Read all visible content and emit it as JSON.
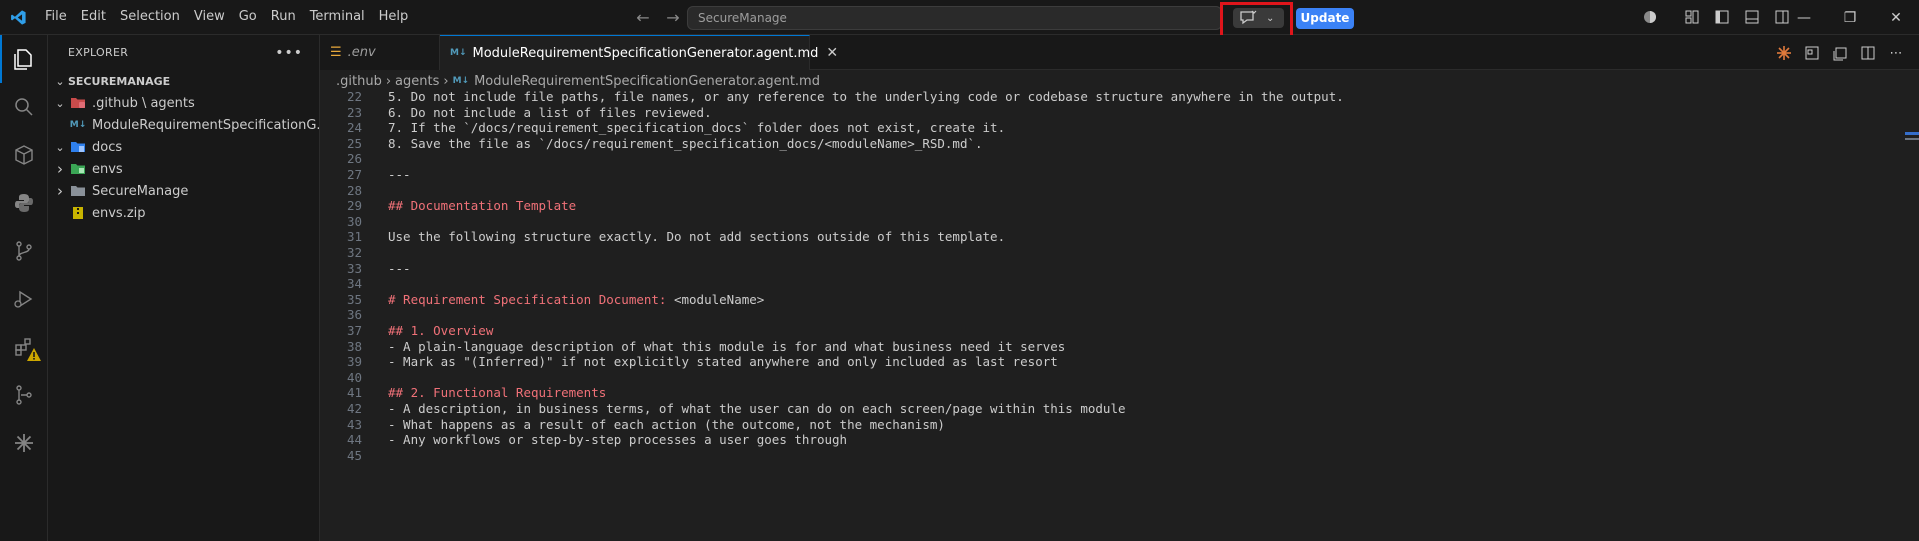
{
  "menu": [
    "File",
    "Edit",
    "Selection",
    "View",
    "Go",
    "Run",
    "Terminal",
    "Help"
  ],
  "command_center": {
    "placeholder": "SecureManage"
  },
  "update_button": "Update",
  "explorer": {
    "title": "EXPLORER",
    "more": "•••",
    "section": "SECUREMANAGE",
    "tree": [
      {
        "label": ".github \\ agents",
        "indent": 1,
        "kind": "folder-open",
        "chevron": "open"
      },
      {
        "label": "ModuleRequirementSpecificationG...",
        "indent": 2,
        "kind": "md",
        "chevron": "none"
      },
      {
        "label": "docs",
        "indent": 1,
        "kind": "folder-docs",
        "chevron": "open"
      },
      {
        "label": "envs",
        "indent": 1,
        "kind": "folder-envs",
        "chevron": "closed"
      },
      {
        "label": "SecureManage",
        "indent": 1,
        "kind": "folder",
        "chevron": "closed"
      },
      {
        "label": "envs.zip",
        "indent": 1,
        "kind": "zip",
        "chevron": "none"
      }
    ]
  },
  "tabs": [
    {
      "label": ".env",
      "active": false
    },
    {
      "label": "ModuleRequirementSpecificationGenerator.agent.md",
      "active": true
    }
  ],
  "breadcrumb": [
    ".github",
    "agents",
    "ModuleRequirementSpecificationGenerator.agent.md"
  ],
  "editor_lines": [
    {
      "n": "22",
      "text": "5. Do not include file paths, file names, or any reference to the underlying code or codebase structure anywhere in the output.",
      "style": "normal"
    },
    {
      "n": "23",
      "text": "6. Do not include a list of files reviewed.",
      "style": "normal"
    },
    {
      "n": "24",
      "text": "7. If the `/docs/requirement_specification_docs` folder does not exist, create it.",
      "style": "normal"
    },
    {
      "n": "25",
      "text": "8. Save the file as `/docs/requirement_specification_docs/<moduleName>_RSD.md`.",
      "style": "normal"
    },
    {
      "n": "26",
      "text": "",
      "style": "normal"
    },
    {
      "n": "27",
      "text": "---",
      "style": "normal"
    },
    {
      "n": "28",
      "text": "",
      "style": "normal"
    },
    {
      "n": "29",
      "text": "## Documentation Template",
      "style": "heading"
    },
    {
      "n": "30",
      "text": "",
      "style": "normal"
    },
    {
      "n": "31",
      "text": "Use the following structure exactly. Do not add sections outside of this template.",
      "style": "normal"
    },
    {
      "n": "32",
      "text": "",
      "style": "normal"
    },
    {
      "n": "33",
      "text": "---",
      "style": "normal"
    },
    {
      "n": "34",
      "text": "",
      "style": "normal"
    },
    {
      "n": "35",
      "text": "# Requirement Specification Document: ",
      "style": "heading",
      "tail": "<moduleName>"
    },
    {
      "n": "36",
      "text": "",
      "style": "normal"
    },
    {
      "n": "37",
      "text": "## 1. Overview",
      "style": "heading"
    },
    {
      "n": "38",
      "text": "- A plain-language description of what this module is for and what business need it serves",
      "style": "normal"
    },
    {
      "n": "39",
      "text": "- Mark as \"(Inferred)\" if not explicitly stated anywhere and only included as last resort",
      "style": "normal"
    },
    {
      "n": "40",
      "text": "",
      "style": "normal"
    },
    {
      "n": "41",
      "text": "## 2. Functional Requirements",
      "style": "heading"
    },
    {
      "n": "42",
      "text": "- A description, in business terms, of what the user can do on each screen/page within this module",
      "style": "normal"
    },
    {
      "n": "43",
      "text": "- What happens as a result of each action (the outcome, not the mechanism)",
      "style": "normal"
    },
    {
      "n": "44",
      "text": "- Any workflows or step-by-step processes a user goes through",
      "style": "normal"
    },
    {
      "n": "45",
      "text": "",
      "style": "normal"
    }
  ],
  "colors": {
    "accent": "#0078d4",
    "update": "#3b82f6",
    "highlight": "#e0151b",
    "heading": "#f07178"
  }
}
